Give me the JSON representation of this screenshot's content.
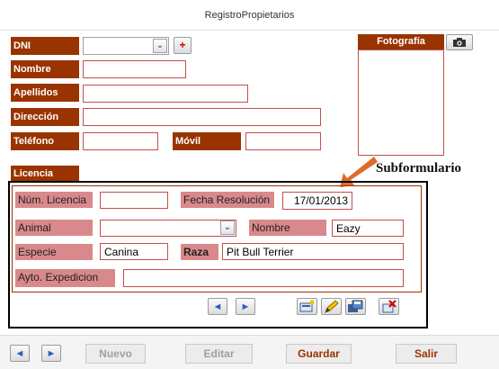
{
  "window": {
    "title": "RegistroPropietarios"
  },
  "owner": {
    "dni_label": "DNI",
    "nombre_label": "Nombre",
    "apellidos_label": "Apellidos",
    "direccion_label": "Dirección",
    "telefono_label": "Teléfono",
    "movil_label": "Móvil",
    "add_button": "+"
  },
  "photo": {
    "label": "Fotografía"
  },
  "licencia": {
    "section_label": "Licencia"
  },
  "annotation": {
    "text": "Subformulario"
  },
  "subform": {
    "num_licencia_label": "Núm. Licencia",
    "fecha_resolucion_label": "Fecha Resolución",
    "fecha_resolucion_value": "17/01/2013",
    "animal_label": "Animal",
    "nombre_label": "Nombre",
    "nombre_value": "Eazy",
    "especie_label": "Especie",
    "especie_value": "Canina",
    "raza_label": "Raza",
    "raza_value": "Pit Bull Terrier",
    "ayto_label": "Ayto. Expedicion"
  },
  "footer": {
    "nuevo": "Nuevo",
    "editar": "Editar",
    "guardar": "Guardar",
    "salir": "Salir"
  },
  "colors": {
    "label_dark": "#993300",
    "label_pink": "#d9898b",
    "field_border": "#c0504d",
    "arrow": "#e06a2a"
  }
}
